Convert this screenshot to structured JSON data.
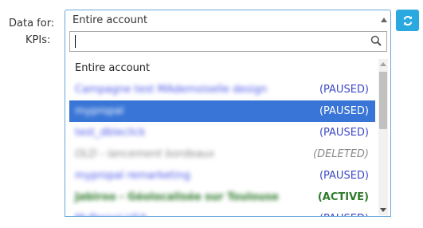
{
  "form": {
    "data_for_label": "Data for:",
    "kpis_label": "KPIs:"
  },
  "select": {
    "value": "Entire account",
    "search_value": ""
  },
  "icons": {
    "refresh": "refresh-icon",
    "search": "search-icon"
  },
  "colors": {
    "accent": "#2aa9e0",
    "selected": "#3875d7",
    "paused": "#3d49c7",
    "active": "#2d7a2a",
    "deleted": "#8a8a8a"
  },
  "options": [
    {
      "name": "Entire account",
      "status": ""
    },
    {
      "name": "Campagne test MAdemoiselle design",
      "status": "(PAUSED)"
    },
    {
      "name": "mypropal",
      "status": "(PAUSED)"
    },
    {
      "name": "test_dbleclick",
      "status": "(PAUSED)"
    },
    {
      "name": "OLD - lancement bordeaux",
      "status": "(DELETED)"
    },
    {
      "name": "mypropal remarketing",
      "status": "(PAUSED)"
    },
    {
      "name": "Jabiroo - Géolocalisée sur Toulouse",
      "status": "(ACTIVE)"
    },
    {
      "name": "MyPropal USA",
      "status": "(PAUSED)"
    }
  ]
}
